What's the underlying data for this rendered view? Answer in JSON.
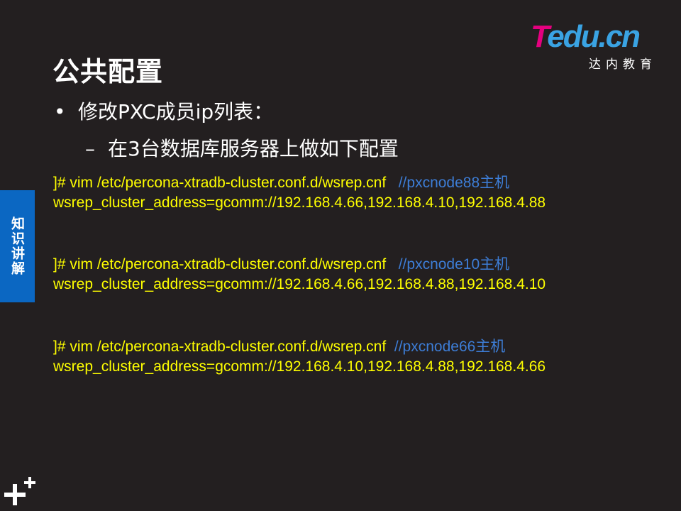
{
  "slide": {
    "title": "公共配置",
    "logo": {
      "main_t": "T",
      "main_rest": "edu.cn",
      "sub": "达内教育"
    },
    "bullet_1": {
      "marker": "•",
      "text": "修改PXC成员ip列表："
    },
    "bullet_2": {
      "marker": "–",
      "text": "在3台数据库服务器上做如下配置"
    },
    "code_blocks": [
      {
        "command": "]# vim /etc/percona-xtradb-cluster.conf.d/wsrep.cnf",
        "comment": "//pxcnode88主机",
        "config": "wsrep_cluster_address=gcomm://192.168.4.66,192.168.4.10,192.168.4.88"
      },
      {
        "command": "]# vim /etc/percona-xtradb-cluster.conf.d/wsrep.cnf",
        "comment": "//pxcnode10主机",
        "config": "wsrep_cluster_address=gcomm://192.168.4.66,192.168.4.88,192.168.4.10"
      },
      {
        "command": "]# vim /etc/percona-xtradb-cluster.conf.d/wsrep.cnf",
        "comment": "//pxcnode66主机",
        "config": "wsrep_cluster_address=gcomm://192.168.4.10,192.168.4.88,192.168.4.66"
      }
    ],
    "side_tab": "知识讲解",
    "colors": {
      "background": "#231f20",
      "code_text": "#ffff00",
      "comment_text": "#3d7dd6",
      "side_tab": "#0b67c2",
      "logo_pink": "#e5007f",
      "logo_blue": "#3aa3e3"
    },
    "icons": {
      "corner": "plus-plus-icon"
    }
  }
}
